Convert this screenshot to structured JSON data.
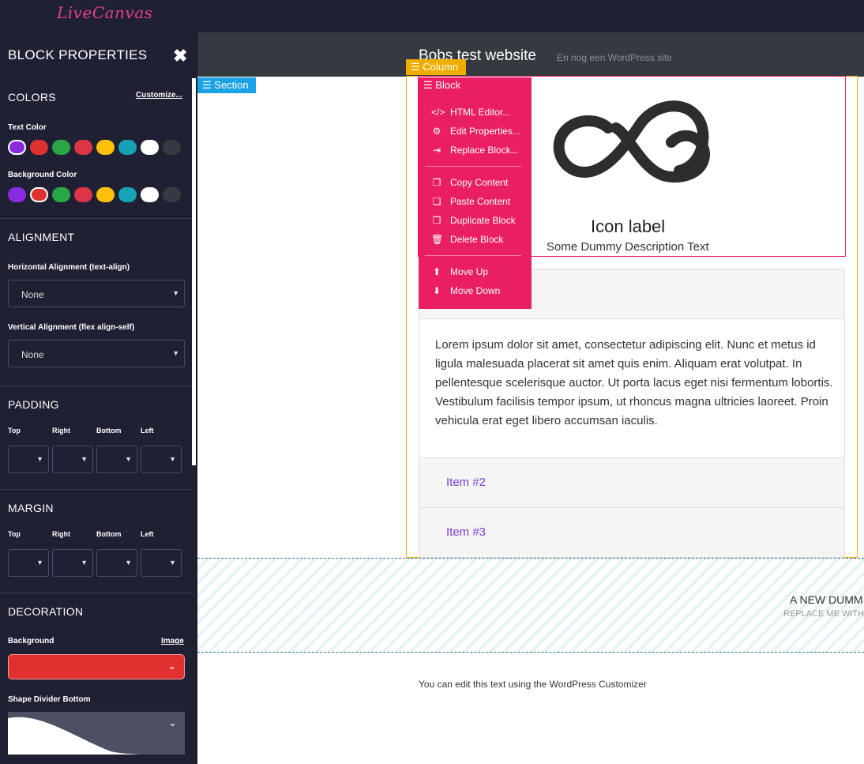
{
  "app": {
    "logo": "LiveCanvas"
  },
  "sidebar": {
    "title": "BLOCK PROPERTIES",
    "close_icon": "close-icon",
    "colors": {
      "title": "COLORS",
      "customize_link": "Customize...",
      "text_color_label": "Text Color",
      "background_color_label": "Background Color",
      "palette": [
        "#8a2be2",
        "#e03131",
        "#28a745",
        "#dc3545",
        "#ffc107",
        "#17a2b8",
        "#ffffff",
        "#343a40"
      ],
      "text_selected_index": 0,
      "background_selected_index": 1
    },
    "alignment": {
      "title": "ALIGNMENT",
      "horizontal_label": "Horizontal Alignment (text-align)",
      "horizontal_value": "None",
      "vertical_label": "Vertical Alignment (flex align-self)",
      "vertical_value": "None"
    },
    "padding": {
      "title": "PADDING",
      "fields": [
        "Top",
        "Right",
        "Bottom",
        "Left"
      ]
    },
    "margin": {
      "title": "MARGIN",
      "fields": [
        "Top",
        "Right",
        "Bottom",
        "Left"
      ]
    },
    "decoration": {
      "title": "DECORATION",
      "background_label": "Background",
      "image_link": "Image",
      "background_value_color": "#e03030",
      "shape_divider_label": "Shape Divider Bottom"
    }
  },
  "site": {
    "title": "Bobs test website",
    "tagline": "En nog een WordPress site"
  },
  "editor": {
    "section_label": "Section",
    "column_label": "Column",
    "block_label": "Block",
    "menu": [
      {
        "label": "HTML Editor...",
        "icon": "code-icon"
      },
      {
        "label": "Edit Properties...",
        "icon": "gear-icon"
      },
      {
        "label": "Replace Block...",
        "icon": "sign-in-icon"
      },
      {
        "label": "Copy Content",
        "icon": "copy-icon"
      },
      {
        "label": "Paste Content",
        "icon": "paste-icon"
      },
      {
        "label": "Duplicate Block",
        "icon": "duplicate-icon"
      },
      {
        "label": "Delete Block",
        "icon": "trash-icon"
      },
      {
        "label": "Move Up",
        "icon": "arrow-up-icon"
      },
      {
        "label": "Move Down",
        "icon": "arrow-down-icon"
      }
    ]
  },
  "content": {
    "icon_name": "cloud-infinity-icon",
    "icon_label": "Icon label",
    "icon_description": "Some Dummy Description Text",
    "accordion": {
      "body": "Lorem ipsum dolor sit amet, consectetur adipiscing elit. Nunc et metus id ligula malesuada placerat sit amet quis enim. Aliquam erat volutpat. In pellentesque scelerisque auctor. Ut porta lacus eget nisi fermentum lobortis. Vestibulum facilisis tempor ipsum, ut rhoncus magna ultricies laoreet. Proin vehicula erat eget libero accumsan iaculis.",
      "items": [
        "Item #2",
        "Item #3"
      ]
    },
    "new_section_title": "A NEW DUMM",
    "new_section_sub": "REPLACE ME WITH",
    "footer_text": "You can edit this text using the WordPress Customizer"
  }
}
